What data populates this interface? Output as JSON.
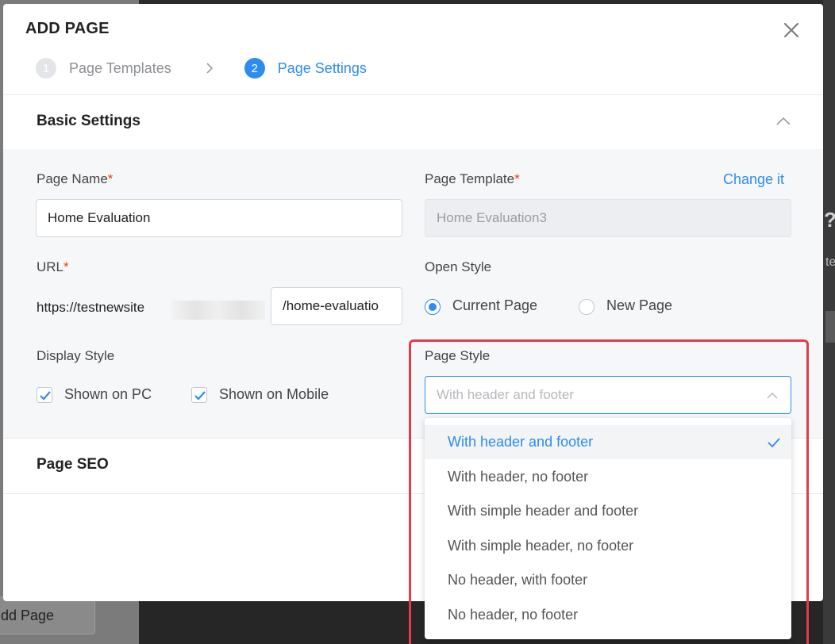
{
  "background": {
    "add_page_button": "dd Page",
    "question_mark": "?",
    "partial_text": "te"
  },
  "modal": {
    "title": "ADD PAGE",
    "steps": [
      {
        "number": "1",
        "label": "Page Templates",
        "state": "inactive"
      },
      {
        "number": "2",
        "label": "Page Settings",
        "state": "active"
      }
    ],
    "basic_settings": {
      "title": "Basic Settings",
      "page_name": {
        "label": "Page Name",
        "required_mark": "*",
        "value": "Home Evaluation"
      },
      "page_template": {
        "label": "Page Template",
        "required_mark": "*",
        "value": "Home Evaluation3",
        "change_link": "Change it"
      },
      "url": {
        "label": "URL",
        "required_mark": "*",
        "prefix": "https://testnewsite",
        "value": "/home-evaluatio"
      },
      "open_style": {
        "label": "Open Style",
        "options": [
          {
            "label": "Current Page",
            "checked": true
          },
          {
            "label": "New Page",
            "checked": false
          }
        ]
      },
      "display_style": {
        "label": "Display Style",
        "options": [
          {
            "label": "Shown on PC",
            "checked": true
          },
          {
            "label": "Shown on Mobile",
            "checked": true
          }
        ]
      },
      "page_style": {
        "label": "Page Style",
        "selected": "With header and footer",
        "options": [
          "With header and footer",
          "With header, no footer",
          "With simple header and footer",
          "With simple header, no footer",
          "No header, with footer",
          "No header, no footer"
        ]
      }
    },
    "seo": {
      "title": "Page SEO"
    }
  },
  "colors": {
    "accent": "#2d8cf0",
    "required": "#ed4014",
    "highlight": "#e43b4c"
  }
}
